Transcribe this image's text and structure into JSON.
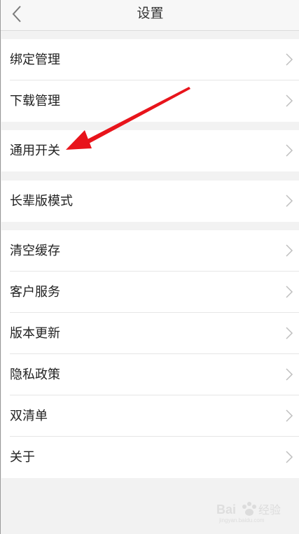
{
  "header": {
    "title": "设置",
    "back_icon": "chevron-left-icon"
  },
  "groups": [
    {
      "items": [
        {
          "label": "绑定管理"
        },
        {
          "label": "下载管理"
        }
      ]
    },
    {
      "items": [
        {
          "label": "通用开关"
        }
      ]
    },
    {
      "items": [
        {
          "label": "长辈版模式"
        }
      ]
    },
    {
      "items": [
        {
          "label": "清空缓存"
        },
        {
          "label": "客户服务"
        },
        {
          "label": "版本更新"
        },
        {
          "label": "隐私政策"
        },
        {
          "label": "双清单"
        },
        {
          "label": "关于"
        }
      ]
    }
  ],
  "annotation": {
    "arrow_color": "#e8141b"
  },
  "watermark": {
    "text": "Baidu 经验",
    "sub": "jingyan.baidu.com"
  },
  "colors": {
    "background": "#f2f2f2",
    "row": "#ffffff",
    "chevron": "#bfbfbf",
    "text": "#222222"
  }
}
